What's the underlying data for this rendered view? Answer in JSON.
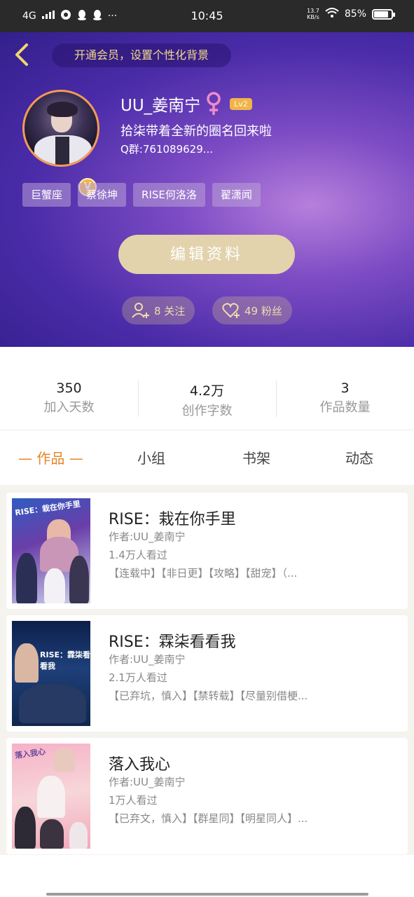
{
  "statusbar": {
    "network": "4G",
    "time": "10:45",
    "speed_value": "13.7",
    "speed_unit": "KB/s",
    "battery": "85%",
    "battery_level": 0.85
  },
  "header": {
    "vip_banner": "开通会员，设置个性化背景",
    "username": "UU_姜南宁",
    "level": "Lv2",
    "bio_line1": "拾柒带着全新的圈名回来啦",
    "bio_line2": "Q群:761089629...",
    "verified_badge": "V",
    "tags": [
      "巨蟹座",
      "蔡徐坤",
      "RISE何洛洛",
      "翟潇闻"
    ],
    "edit_button": "编辑资料",
    "follow_label": "8 关注",
    "fans_label": "49 粉丝"
  },
  "stats": [
    {
      "num": "350",
      "label": "加入天数"
    },
    {
      "num": "4.2万",
      "label": "创作字数"
    },
    {
      "num": "3",
      "label": "作品数量"
    }
  ],
  "tabs": {
    "works": "— 作品 —",
    "groups": "小组",
    "bookshelf": "书架",
    "feed": "动态"
  },
  "works": [
    {
      "title": "RISE：栽在你手里",
      "author": "作者:UU_姜南宁",
      "views": "1.4万人看过",
      "tags": "【连载中】【非日更】【攻略】【甜宠】（...",
      "cover_text": "RISE：栽在你手里"
    },
    {
      "title": "RISE：霖柒看看我",
      "author": "作者:UU_姜南宁",
      "views": "2.1万人看过",
      "tags": "【已弃坑，慎入】【禁转载】【尽量别借梗...",
      "cover_text": "RISE：霖柒看看我"
    },
    {
      "title": "落入我心",
      "author": "作者:UU_姜南宁",
      "views": "1万人看过",
      "tags": "【已弃文，慎入】【群星同】【明星同人】...",
      "cover_text": "落入我心"
    }
  ],
  "colors": {
    "accent": "#e6852a",
    "header_purple": "#4a2ba8",
    "gold": "#e2d3ad",
    "level_badge": "#f1b44a"
  }
}
